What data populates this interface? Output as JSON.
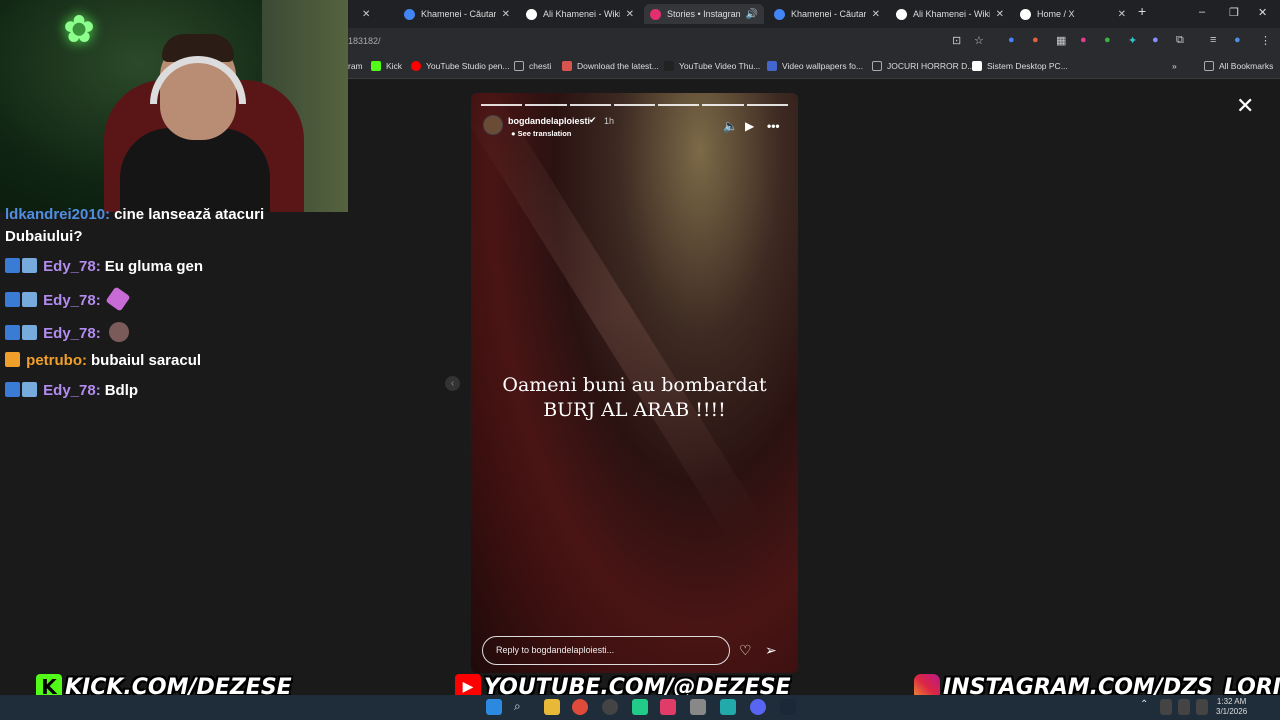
{
  "browser": {
    "tabs": [
      {
        "label": "Khamenei - Căutare Google",
        "color": "#4285f4"
      },
      {
        "label": "Ali Khamenei - Wikipedia",
        "color": "#ffffff"
      },
      {
        "label": "Stories • Instagram",
        "color": "#e1306c"
      },
      {
        "label": "Khamenei - Căutare Google",
        "color": "#4285f4"
      },
      {
        "label": "Ali Khamenei - Wikipedia",
        "color": "#ffffff"
      },
      {
        "label": "Home / X",
        "color": "#ffffff"
      }
    ],
    "url": "183182/",
    "bookmarks": [
      {
        "label": "ram",
        "color": "#e1306c"
      },
      {
        "label": "Kick",
        "color": "#53fc18"
      },
      {
        "label": "YouTube Studio pen...",
        "color": "#ff0000"
      },
      {
        "label": "chesti",
        "color": "#aaaaaa"
      },
      {
        "label": "Download the latest...",
        "color": "#d9534f"
      },
      {
        "label": "YouTube Video Thu...",
        "color": "#222222"
      },
      {
        "label": "Video wallpapers fo...",
        "color": "#4466cc"
      },
      {
        "label": "JOCURI HORROR D...",
        "color": "#aaaaaa"
      },
      {
        "label": "Sistem Desktop PC...",
        "color": "#ffffff"
      }
    ],
    "all_bookmarks": "All Bookmarks"
  },
  "chat": {
    "messages": [
      {
        "user": "ldkandrei2010:",
        "text": "cine lansează atacuri",
        "user_color": "#4f8fe0"
      },
      {
        "user": "",
        "text": "Dubaiului?",
        "user_color": "#ffffff"
      },
      {
        "user": "Edy_78:",
        "text": "Eu gluma gen",
        "user_color": "#b38cf0"
      },
      {
        "user": "Edy_78:",
        "text": "",
        "user_color": "#b38cf0"
      },
      {
        "user": "Edy_78:",
        "text": "",
        "user_color": "#b38cf0"
      },
      {
        "user": "petrubo:",
        "text": "bubaiul saracul",
        "user_color": "#f0a02a"
      },
      {
        "user": "Edy_78:",
        "text": "Bdlp",
        "user_color": "#b38cf0"
      }
    ]
  },
  "story": {
    "username": "bogdandelaploiesti",
    "time": "1h",
    "see_translation": "See translation",
    "caption_line1": "Oameni buni au bombardat",
    "caption_line2": "BURJ AL ARAB !!!!",
    "reply_placeholder": "Reply to bogdandelaploiesti...",
    "segments": 7
  },
  "banner": {
    "kick": "KICK.COM/DEZESE",
    "youtube": "YOUTUBE.COM/@DEZESE",
    "instagram": "INSTAGRAM.COM/DZS_LORI"
  },
  "taskbar": {
    "time": "1:32 AM",
    "date": "3/1/2026"
  }
}
